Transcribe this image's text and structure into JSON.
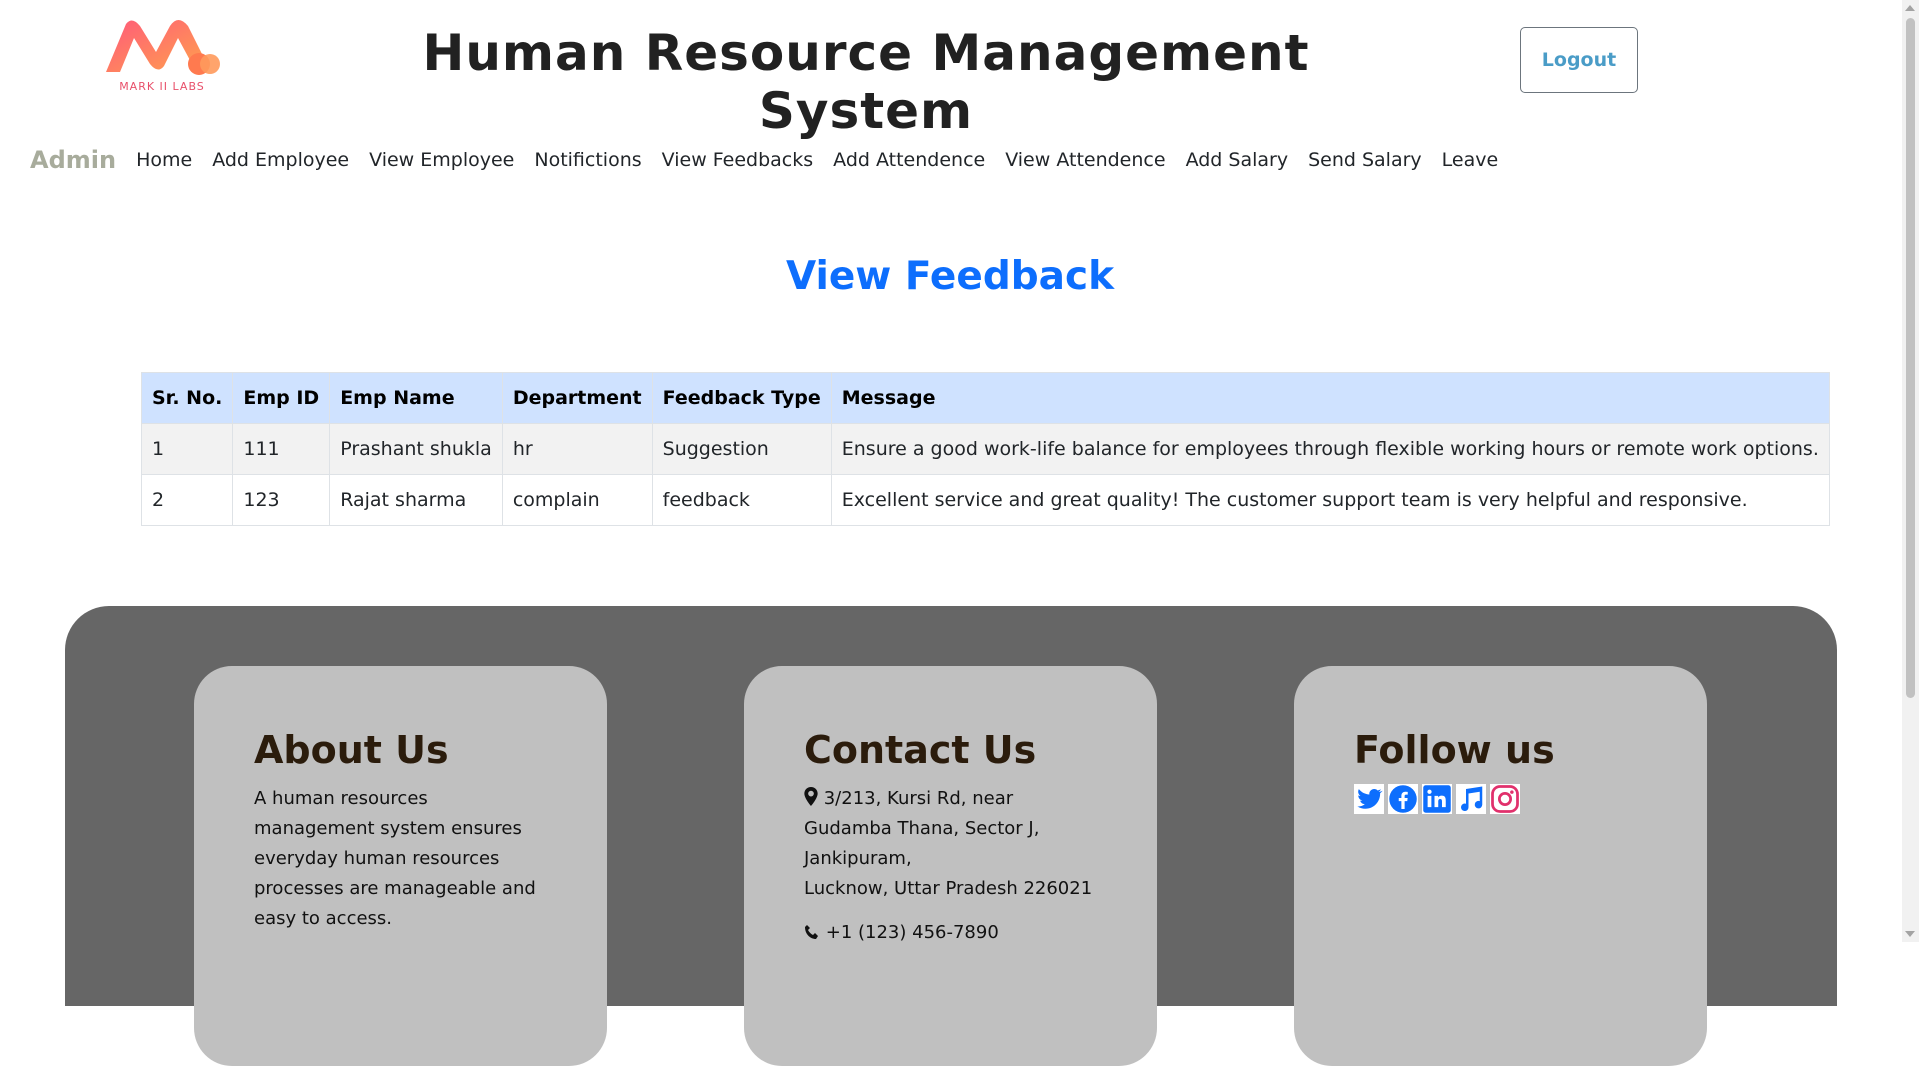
{
  "header": {
    "logo_text": "MARK II LABS",
    "title": "Human Resource Management System",
    "logout_label": "Logout"
  },
  "nav": {
    "brand": "Admin",
    "items": [
      {
        "label": "Home"
      },
      {
        "label": "Add Employee"
      },
      {
        "label": "View Employee"
      },
      {
        "label": "Notifictions"
      },
      {
        "label": "View Feedbacks"
      },
      {
        "label": "Add Attendence"
      },
      {
        "label": "View Attendence"
      },
      {
        "label": "Add Salary"
      },
      {
        "label": "Send Salary"
      },
      {
        "label": "Leave"
      }
    ]
  },
  "main": {
    "heading": "View Feedback",
    "table": {
      "columns": [
        "Sr. No.",
        "Emp ID",
        "Emp Name",
        "Department",
        "Feedback Type",
        "Message"
      ],
      "rows": [
        [
          "1",
          "111",
          "Prashant shukla",
          "hr",
          "Suggestion",
          "Ensure a good work-life balance for employees through flexible working hours or remote work options."
        ],
        [
          "2",
          "123",
          "Rajat sharma",
          "complain",
          "feedback",
          "Excellent service and great quality! The customer support team is very helpful and responsive."
        ]
      ]
    }
  },
  "footer": {
    "about": {
      "title": "About Us",
      "text": "A human resources management system ensures everyday human resources processes are manageable and easy to access."
    },
    "contact": {
      "title": "Contact Us",
      "address_lines": [
        "3/213, Kursi Rd, near",
        "Gudamba Thana, Sector J,",
        "Jankipuram,",
        "Lucknow, Uttar Pradesh 226021"
      ],
      "phone": "+1 (123) 456-7890"
    },
    "follow": {
      "title": "Follow us",
      "icons": [
        "twitter-icon",
        "facebook-icon",
        "linkedin-icon",
        "music-icon",
        "instagram-icon"
      ]
    }
  },
  "colors": {
    "heading": "#0d6efd",
    "table_header": "#cfe2ff",
    "footer_bg": "#666666",
    "card_bg": "#c0c0c0",
    "social_blue": "#0d6efd",
    "instagram": "#e1306c",
    "logout_text": "#4a9cc7"
  }
}
